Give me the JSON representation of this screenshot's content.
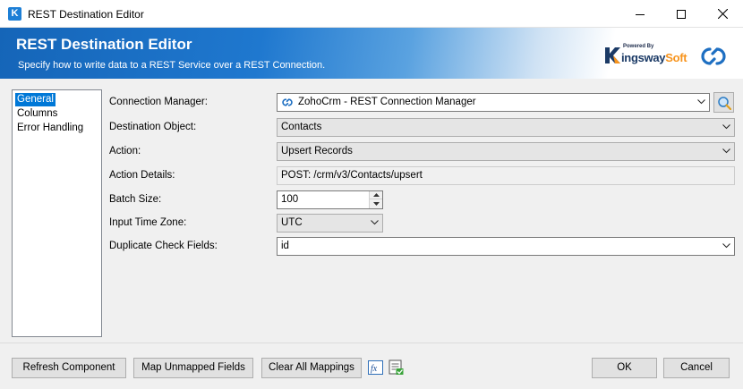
{
  "window": {
    "title": "REST Destination Editor"
  },
  "header": {
    "title": "REST Destination Editor",
    "subtitle": "Specify how to write data to a REST Service over a REST Connection.",
    "logo_powered": "Powered By",
    "logo_text_main": "ingsway",
    "logo_text_accent": "Soft"
  },
  "sidebar": {
    "items": [
      {
        "label": "General",
        "selected": true
      },
      {
        "label": "Columns",
        "selected": false
      },
      {
        "label": "Error Handling",
        "selected": false
      }
    ]
  },
  "form": {
    "connection_manager": {
      "label": "Connection Manager:",
      "value": "ZohoCrm - REST Connection Manager"
    },
    "destination_object": {
      "label": "Destination Object:",
      "value": "Contacts"
    },
    "action": {
      "label": "Action:",
      "value": "Upsert Records"
    },
    "action_details": {
      "label": "Action Details:",
      "value": "POST: /crm/v3/Contacts/upsert"
    },
    "batch_size": {
      "label": "Batch Size:",
      "value": "100"
    },
    "input_time_zone": {
      "label": "Input Time Zone:",
      "value": "UTC"
    },
    "duplicate_check_fields": {
      "label": "Duplicate Check Fields:",
      "value": "id"
    }
  },
  "footer": {
    "refresh_label": "Refresh Component",
    "map_unmapped_label": "Map Unmapped Fields",
    "clear_mappings_label": "Clear All Mappings",
    "ok_label": "OK",
    "cancel_label": "Cancel"
  },
  "colors": {
    "accent": "#0078d7",
    "header_blue": "#1565b8",
    "brand_orange": "#f7941d"
  }
}
